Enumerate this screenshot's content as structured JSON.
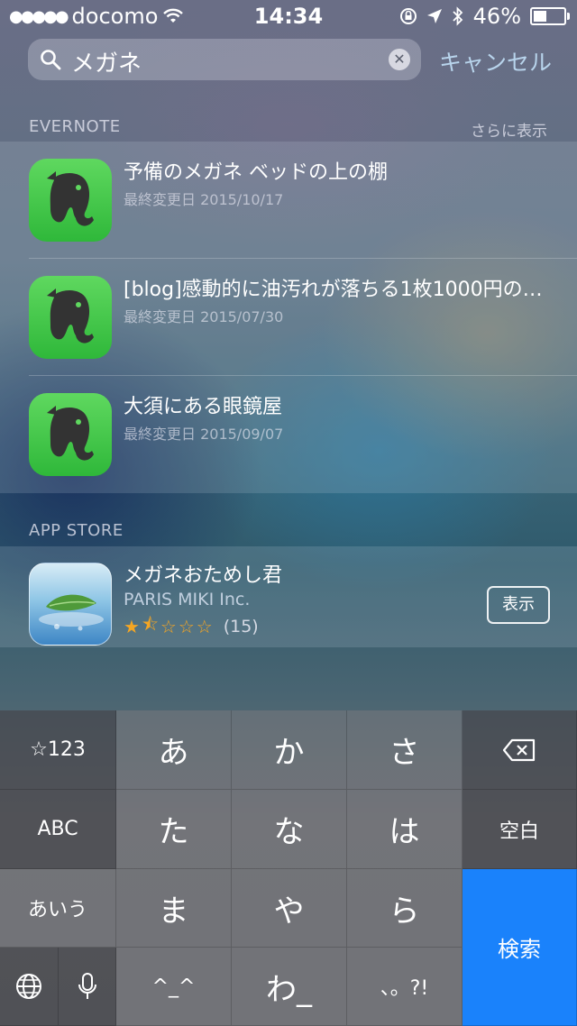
{
  "status_bar": {
    "carrier": "docomo",
    "time": "14:34",
    "battery": "46%",
    "battery_level": 0.46
  },
  "search": {
    "query": "メガネ",
    "cancel_label": "キャンセル"
  },
  "evernote": {
    "section_title": "EVERNOTE",
    "more_label": "さらに表示",
    "results": [
      {
        "title": "予備のメガネ ベッドの上の棚",
        "subtitle": "最終変更日 2015/10/17"
      },
      {
        "title": "[blog]感動的に油汚れが落ちる1枚1000円のメ…",
        "subtitle": "最終変更日 2015/07/30"
      },
      {
        "title": "大須にある眼鏡屋",
        "subtitle": "最終変更日 2015/09/07"
      }
    ]
  },
  "app_store": {
    "section_title": "APP STORE",
    "app": {
      "name": "メガネおためし君",
      "developer": "PARIS MIKI Inc.",
      "rating": 1.5,
      "rating_count": "(15)",
      "action_label": "表示"
    }
  },
  "keyboard": {
    "rows": [
      [
        "☆123",
        "あ",
        "か",
        "さ",
        "delete"
      ],
      [
        "ABC",
        "た",
        "な",
        "は",
        "空白"
      ],
      [
        "あいう",
        "ま",
        "や",
        "ら",
        "検索"
      ],
      [
        "globe",
        "mic",
        "^_^",
        "わ_",
        "、。?!"
      ]
    ],
    "k_123": "☆123",
    "k_a": "あ",
    "k_ka": "か",
    "k_sa": "さ",
    "k_abc": "ABC",
    "k_ta": "た",
    "k_na": "な",
    "k_ha": "は",
    "k_space": "空白",
    "k_aiu": "あいう",
    "k_ma": "ま",
    "k_ya": "や",
    "k_ra": "ら",
    "k_search": "検索",
    "k_kao": "^_^",
    "k_wa": "わ_",
    "k_punct": "、。?!"
  }
}
